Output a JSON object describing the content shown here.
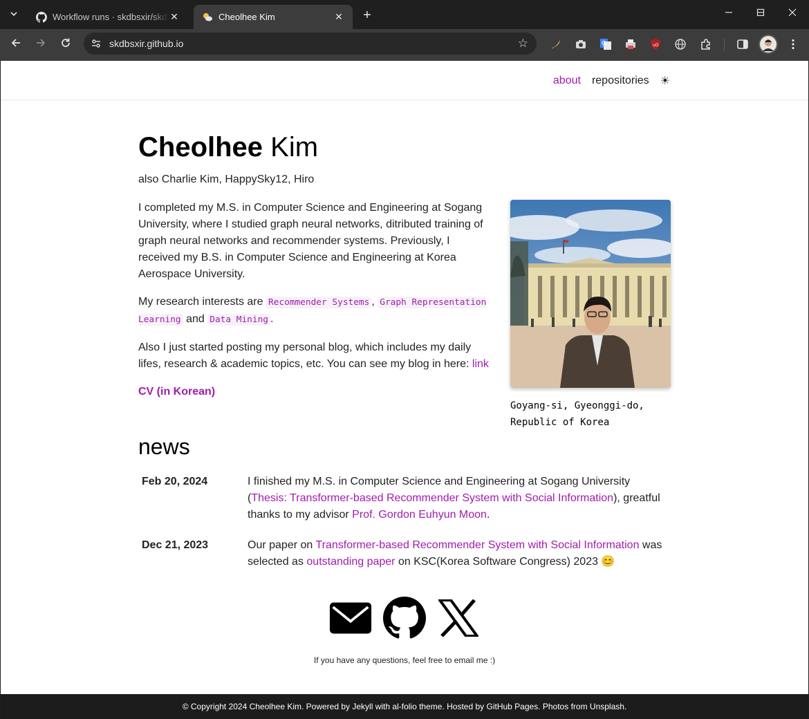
{
  "browser": {
    "tabs": [
      {
        "title": "Workflow runs · skdbsxir/skdbsxir.github.io",
        "active": false
      },
      {
        "title": "Cheolhee Kim",
        "active": true
      }
    ],
    "url": "skdbsxir.github.io",
    "new_tab": "+",
    "window_controls": {
      "minimize": "—",
      "maximize": "☐",
      "close": "✕"
    }
  },
  "site": {
    "nav": {
      "about": "about",
      "repositories": "repositories",
      "theme_toggle": "☀"
    },
    "title_first": "Cheolhee",
    "title_last": "Kim",
    "subtitle": "also Charlie Kim, HappySky12, Hiro",
    "bio": {
      "p1": "I completed my M.S. in Computer Science and Engineering at Sogang University, where I studied graph neural networks, ditributed training of graph neural networks and recommender systems. Previously, I received my B.S. in Computer Science and Engineering at Korea Aerospace University.",
      "p2_prefix": "My research interests are ",
      "interests": [
        "Recommender Systems",
        "Graph Representation Learning",
        "Data Mining"
      ],
      "p2_sep1": ", ",
      "p2_and": " and ",
      "p2_end": ".",
      "p3_text": "Also I just started posting my personal blog, which includes my daily lifes, research & academic topics, etc. You can see my blog in here: ",
      "p3_link": "link",
      "cv_link": "CV (in Korean)"
    },
    "photo_caption": "Goyang-si, Gyeonggi-do, Republic of Korea",
    "news_title": "news",
    "news": [
      {
        "date": "Feb 20, 2024",
        "t1": "I finished my M.S. in Computer Science and Engineering at Sogang University (",
        "l1": "Thesis: Transformer-based Recommender System with Social Information",
        "t2": "), greatful thanks to my advisor ",
        "l2": "Prof. Gordon Euhyun Moon",
        "t3": "."
      },
      {
        "date": "Dec 21, 2023",
        "t1": "Our paper on ",
        "l1": "Transformer-based Recommender System with Social Information",
        "t2": " was selected as ",
        "l2": "outstanding paper",
        "t3": " on KSC(Korea Software Congress) 2023 😊"
      }
    ],
    "contact_note": "If you have any questions, feel free to email me :)",
    "footer": {
      "copyright": "© Copyright 2024 Cheolhee Kim. Powered by ",
      "jekyll": "Jekyll",
      "with": " with ",
      "alfolio": "al-folio",
      "theme": " theme. Hosted by ",
      "ghpages": "GitHub Pages",
      "photos": ". Photos from ",
      "unsplash": "Unsplash",
      "end": "."
    }
  }
}
